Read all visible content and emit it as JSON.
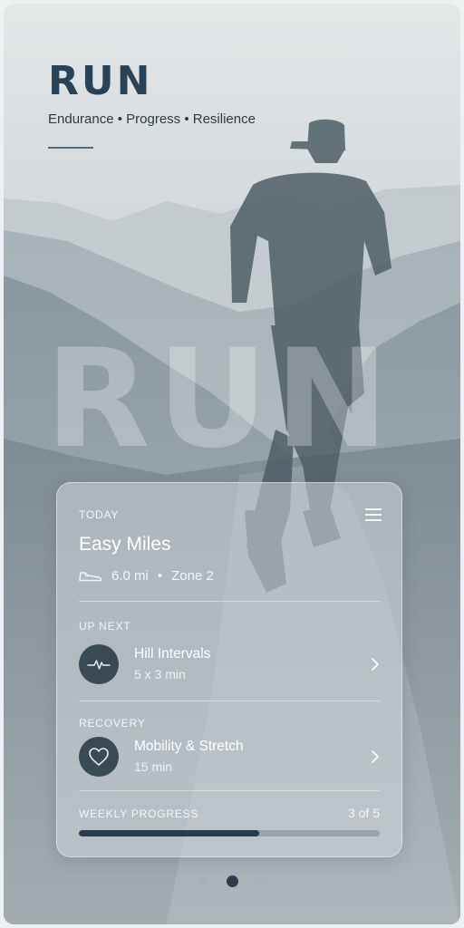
{
  "header": {
    "title": "RUN",
    "tagline": "Endurance • Progress • Resilience",
    "watermark": "RUN"
  },
  "today": {
    "label": "TODAY",
    "workout": "Easy Miles",
    "distance": "6.0 mi",
    "separator": "•",
    "zone": "Zone 2",
    "icons": {
      "menu": "menu-icon",
      "distance": "shoe-icon"
    }
  },
  "up_next": {
    "label": "UP NEXT",
    "name": "Hill Intervals",
    "detail": "5 x 3 min",
    "icon": "heartbeat-icon"
  },
  "recovery": {
    "label": "RECOVERY",
    "name": "Mobility & Stretch",
    "detail": "15 min",
    "icon": "heart-icon"
  },
  "weekly_progress": {
    "label": "WEEKLY PROGRESS",
    "count_text": "3 of 5",
    "completed": 3,
    "total": 5
  },
  "pager": {
    "pages": 3,
    "active_index": 1
  },
  "colors": {
    "title": "#2a4256",
    "icon_circle": "#3a4a55",
    "progress_fill": "#2a3d4c",
    "pager_active": "#2c3e4b"
  }
}
